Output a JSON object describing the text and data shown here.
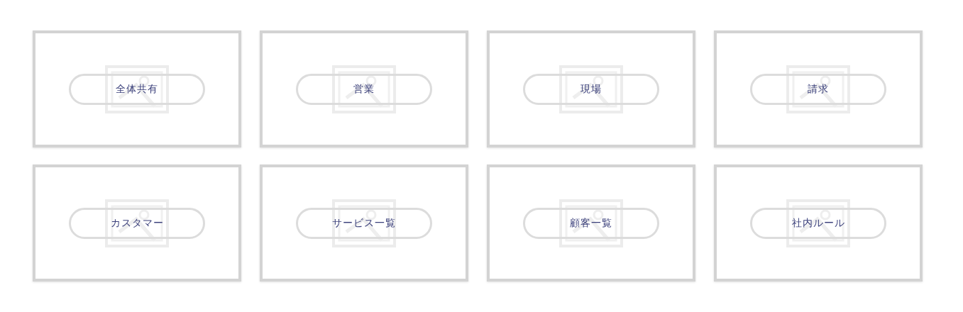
{
  "categories": [
    {
      "label": "全体共有"
    },
    {
      "label": "営業"
    },
    {
      "label": "現場"
    },
    {
      "label": "請求"
    },
    {
      "label": "カスタマー"
    },
    {
      "label": "サービス一覧"
    },
    {
      "label": "顧客一覧"
    },
    {
      "label": "社内ルール"
    }
  ]
}
